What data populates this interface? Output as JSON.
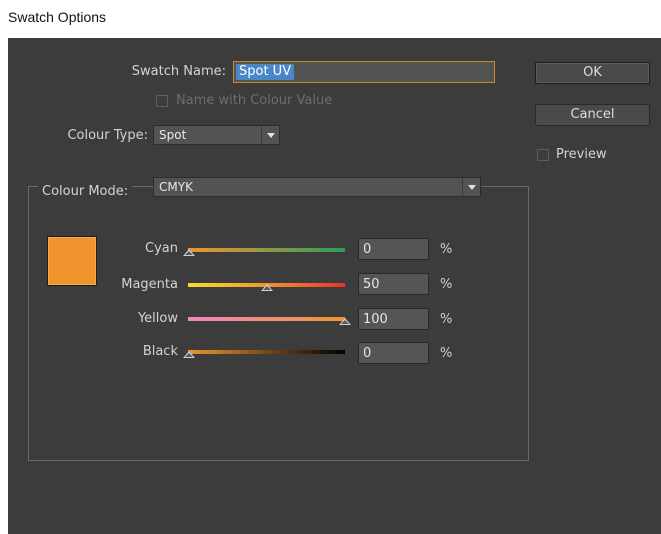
{
  "window": {
    "title": "Swatch Options"
  },
  "swatch_name": {
    "label": "Swatch Name:",
    "value": "Spot UV"
  },
  "name_with_colour_value": {
    "label": "Name with Colour Value",
    "checked": false,
    "enabled": false
  },
  "colour_type": {
    "label": "Colour Type:",
    "selected": "Spot"
  },
  "colour_mode": {
    "label": "Colour Mode:",
    "selected": "CMYK"
  },
  "buttons": {
    "ok": "OK",
    "cancel": "Cancel"
  },
  "preview": {
    "label": "Preview",
    "checked": false
  },
  "swatch_color": "#f0952e",
  "sliders": [
    {
      "label": "Cyan",
      "value": "0",
      "unit": "%"
    },
    {
      "label": "Magenta",
      "value": "50",
      "unit": "%"
    },
    {
      "label": "Yellow",
      "value": "100",
      "unit": "%"
    },
    {
      "label": "Black",
      "value": "0",
      "unit": "%"
    }
  ],
  "colors": {
    "panel": "#3c3c3c",
    "focus_border": "#d48a2a",
    "selection": "#4a86c8"
  }
}
